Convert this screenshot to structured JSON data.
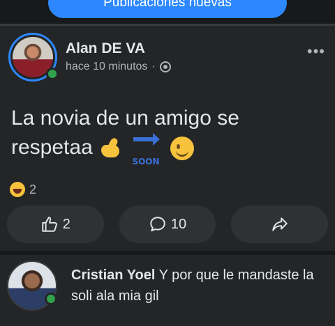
{
  "banner": {
    "new_posts_label": "Publicaciones nuevas"
  },
  "post": {
    "author": "Alan DE VA",
    "time": "hace 10 minutos",
    "separator": "·",
    "text": "La novia de un amigo se respetaa",
    "reaction_count": "2",
    "like_count": "2",
    "comment_count": "10",
    "soon_label": "SOON"
  },
  "comment": {
    "author": "Cristian Yoel",
    "text": "Y por que le mandaste la soli ala mia gil"
  },
  "icons": {
    "globe": "globe-icon",
    "more": "more-options-icon",
    "like": "thumbs-up-icon",
    "comment": "comment-icon",
    "share": "share-icon",
    "haha": "haha-reaction-icon"
  },
  "colors": {
    "accent": "#2d88ff",
    "online": "#31a24c",
    "background": "#18191a",
    "card": "#242526"
  }
}
